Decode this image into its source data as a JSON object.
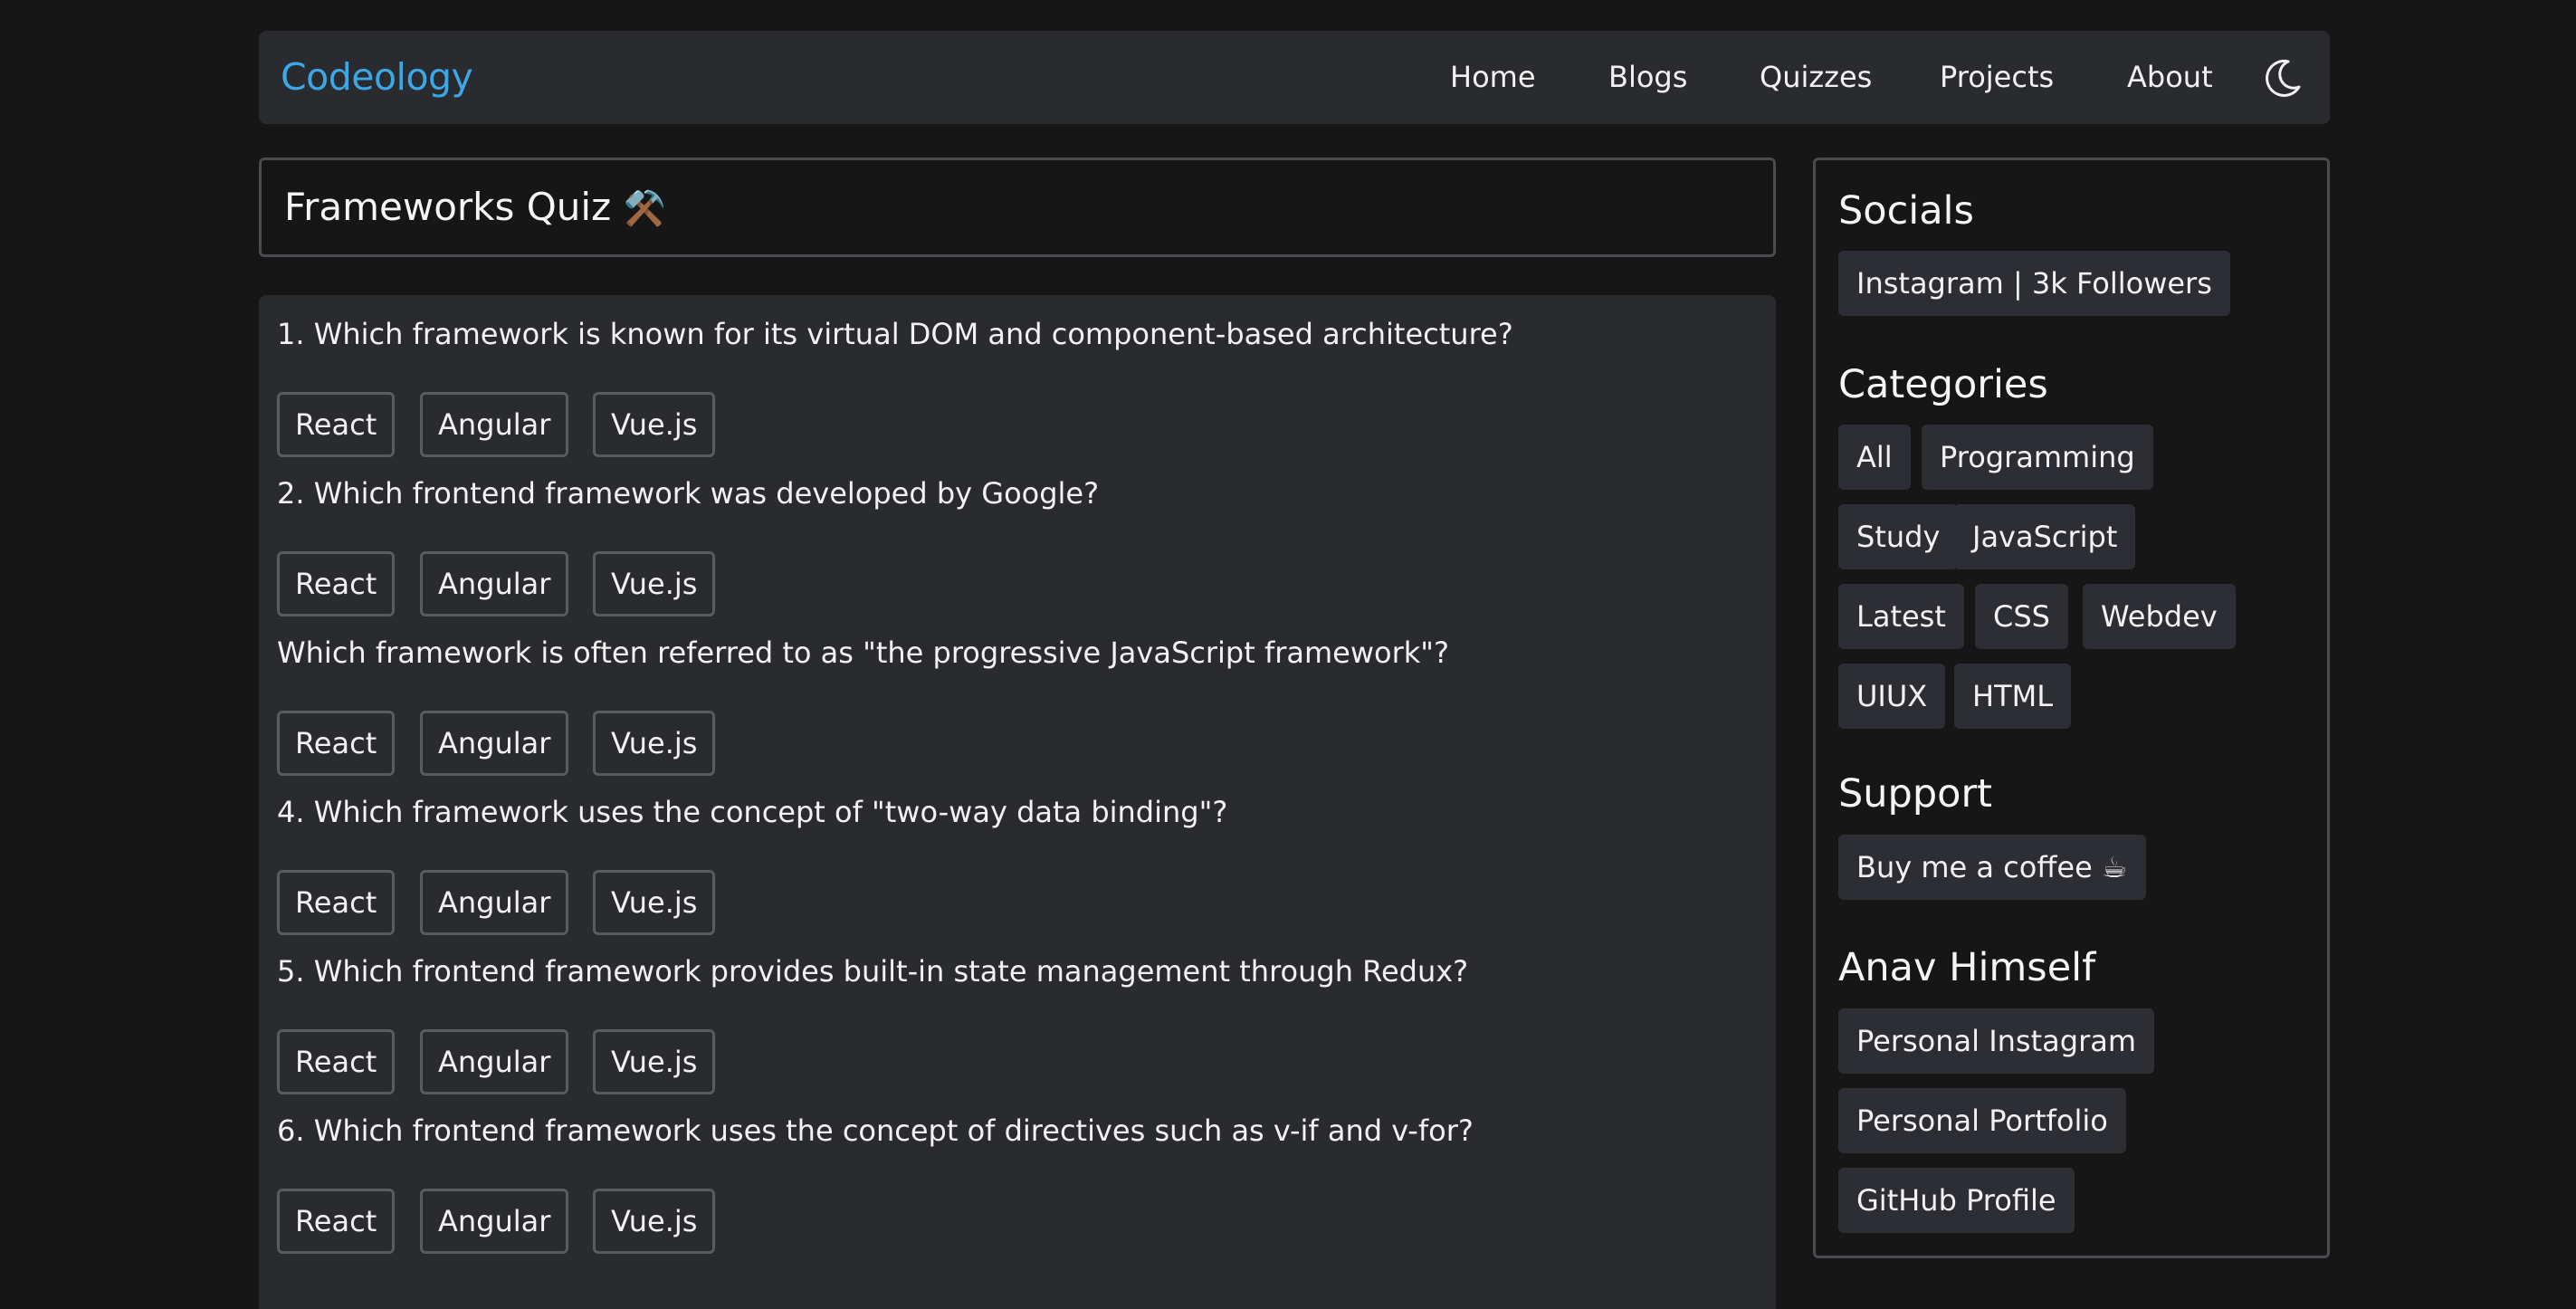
{
  "navbar": {
    "brand": "Codeology",
    "links": [
      "Home",
      "Blogs",
      "Quizzes",
      "Projects",
      "About"
    ],
    "theme_icon": "moon-icon"
  },
  "quiz": {
    "title": "Frameworks Quiz",
    "title_emoji": "⚒️",
    "questions": [
      {
        "text": "1. Which framework is known for its virtual DOM and component-based architecture?",
        "options": [
          "React",
          "Angular",
          "Vue.js"
        ]
      },
      {
        "text": "2. Which frontend framework was developed by Google?",
        "options": [
          "React",
          "Angular",
          "Vue.js"
        ]
      },
      {
        "text": "Which framework is often referred to as \"the progressive JavaScript framework\"?",
        "options": [
          "React",
          "Angular",
          "Vue.js"
        ]
      },
      {
        "text": "4. Which framework uses the concept of \"two-way data binding\"?",
        "options": [
          "React",
          "Angular",
          "Vue.js"
        ]
      },
      {
        "text": "5. Which frontend framework provides built-in state management through Redux?",
        "options": [
          "React",
          "Angular",
          "Vue.js"
        ]
      },
      {
        "text": "6. Which frontend framework uses the concept of directives such as v-if and v-for?",
        "options": [
          "React",
          "Angular",
          "Vue.js"
        ]
      }
    ]
  },
  "sidebar": {
    "socials_heading": "Socials",
    "socials": [
      "Instagram | 3k Followers"
    ],
    "categories_heading": "Categories",
    "categories": [
      "All",
      "Programming",
      "Study",
      "JavaScript",
      "Latest",
      "CSS",
      "Webdev",
      "UIUX",
      "HTML"
    ],
    "support_heading": "Support",
    "support": [
      "Buy me a coffee ☕"
    ],
    "author_heading": "Anav Himself",
    "author_links": [
      "Personal Instagram",
      "Personal Portfolio",
      "GitHub Profile"
    ]
  },
  "colors": {
    "background": "#161617",
    "panel": "#2a2b2f",
    "brand": "#3ba7e6",
    "border": "#4a4b50"
  }
}
